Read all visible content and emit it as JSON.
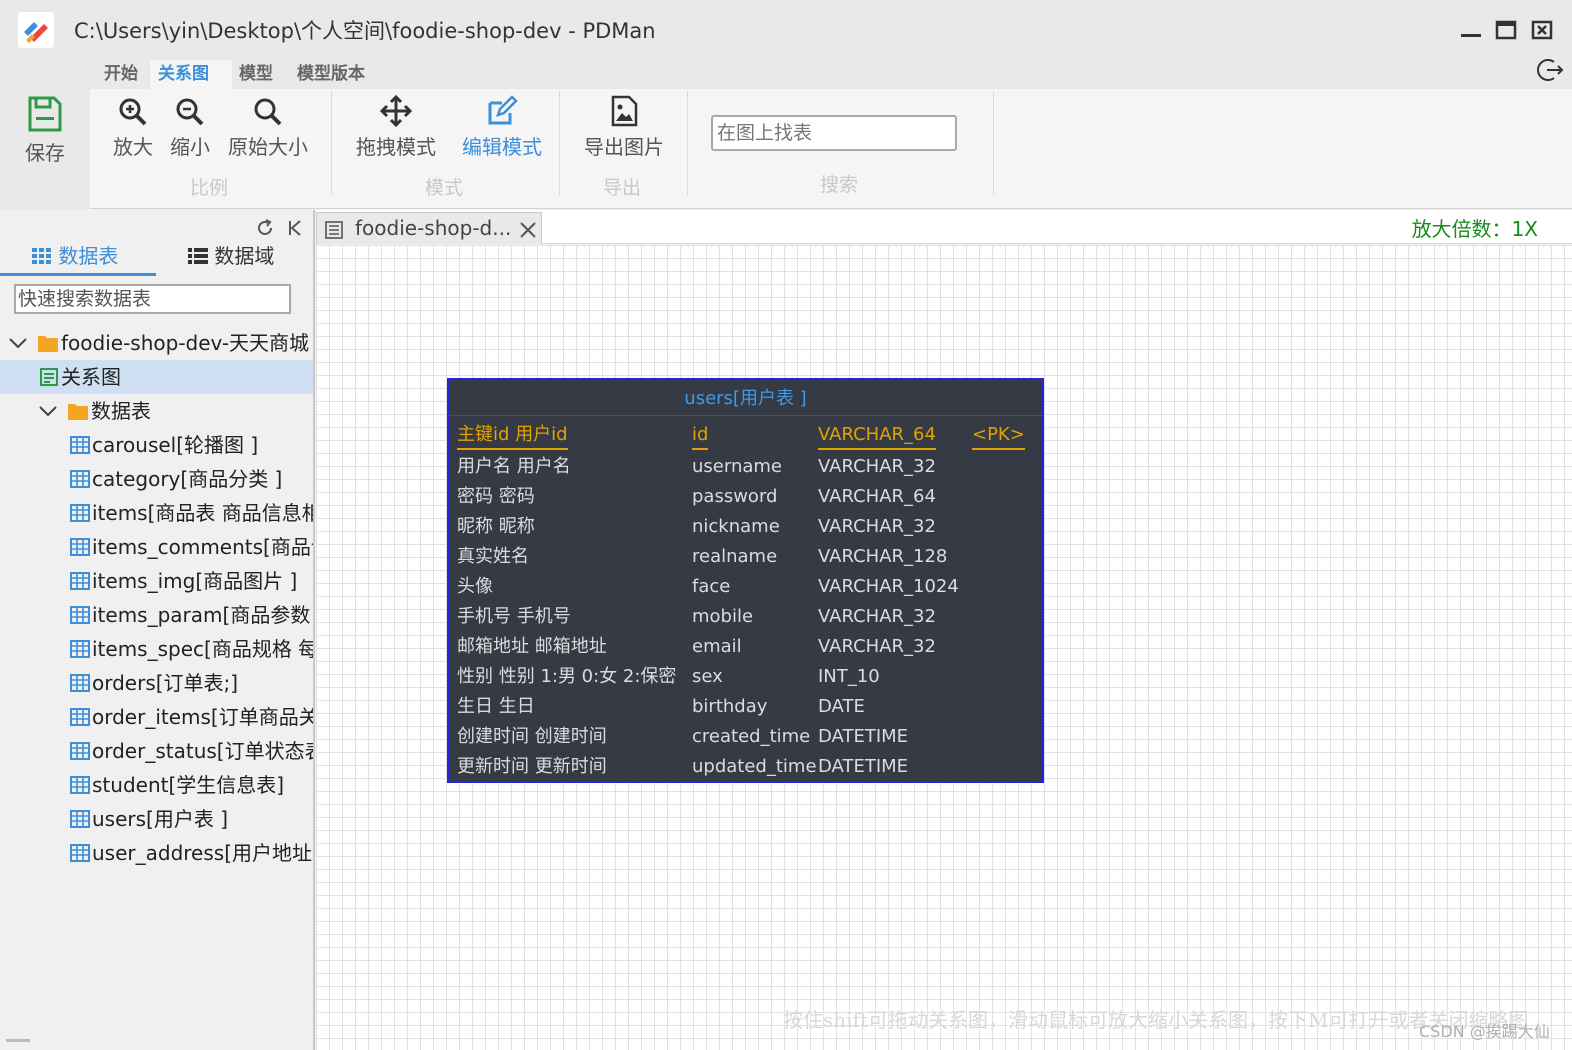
{
  "window": {
    "title": "C:\\Users\\yin\\Desktop\\个人空间\\foodie-shop-dev - PDMan",
    "app_icon": "pdman-logo-icon",
    "controls": [
      "minimize-icon",
      "maximize-icon",
      "close-icon"
    ]
  },
  "menu": {
    "tabs": [
      {
        "label": "开始",
        "active": false
      },
      {
        "label": "关系图",
        "active": true
      },
      {
        "label": "模型",
        "active": false
      },
      {
        "label": "模型版本",
        "active": false
      }
    ],
    "logout_icon": "logout-icon"
  },
  "ribbon": {
    "save": {
      "label": "保存",
      "icon": "save-icon"
    },
    "scale_group": {
      "label": "比例",
      "zoom_in": {
        "label": "放大",
        "icon": "zoom-in-icon"
      },
      "zoom_out": {
        "label": "缩小",
        "icon": "zoom-out-icon"
      },
      "original": {
        "label": "原始大小",
        "icon": "search-icon"
      }
    },
    "mode_group": {
      "label": "模式",
      "drag": {
        "label": "拖拽模式",
        "icon": "move-icon"
      },
      "edit": {
        "label": "编辑模式",
        "icon": "edit-icon",
        "active": true
      }
    },
    "export_group": {
      "label": "导出",
      "export_image": {
        "label": "导出图片",
        "icon": "image-file-icon"
      }
    },
    "search_group": {
      "label": "搜索",
      "placeholder": "在图上找表"
    },
    "accent_color": "#3d8fd8"
  },
  "sidebar": {
    "tabs": [
      {
        "label": "数据表",
        "active": true,
        "icon": "grid-icon"
      },
      {
        "label": "数据域",
        "active": false,
        "icon": "list-icon"
      }
    ],
    "tools": [
      "refresh-icon",
      "collapse-icon"
    ],
    "search_placeholder": "快速搜索数据表",
    "tree": {
      "project": "foodie-shop-dev-天天商城",
      "diagram": "关系图",
      "folder": "数据表",
      "tables": [
        "carousel[轮播图 ]",
        "category[商品分类 ]",
        "items[商品表 商品信息相",
        "items_comments[商品评",
        "items_img[商品图片 ]",
        "items_param[商品参数 ]",
        "items_spec[商品规格 每一",
        "orders[订单表;]",
        "order_items[订单商品关",
        "order_status[订单状态表",
        "student[学生信息表]",
        "users[用户表 ]",
        "user_address[用户地址表"
      ]
    }
  },
  "doc_tab": {
    "label": "foodie-shop-d...",
    "icon": "document-icon",
    "close_icon": "close-icon"
  },
  "zoom_text": "放大倍数：1X",
  "zoom_color": "#1a8a1a",
  "entity": {
    "title": "users[用户表 ]",
    "fields": [
      {
        "comment": "主键id 用户id",
        "name": "id",
        "type": "VARCHAR_64",
        "key": "<PK>"
      },
      {
        "comment": "用户名 用户名",
        "name": "username",
        "type": "VARCHAR_32",
        "key": ""
      },
      {
        "comment": "密码 密码",
        "name": "password",
        "type": "VARCHAR_64",
        "key": ""
      },
      {
        "comment": "昵称 昵称",
        "name": "nickname",
        "type": "VARCHAR_32",
        "key": ""
      },
      {
        "comment": "真实姓名",
        "name": "realname",
        "type": "VARCHAR_128",
        "key": ""
      },
      {
        "comment": "头像",
        "name": "face",
        "type": "VARCHAR_1024",
        "key": ""
      },
      {
        "comment": "手机号 手机号",
        "name": "mobile",
        "type": "VARCHAR_32",
        "key": ""
      },
      {
        "comment": "邮箱地址 邮箱地址",
        "name": "email",
        "type": "VARCHAR_32",
        "key": ""
      },
      {
        "comment": "性别 性别 1:男  0:女  2:保密",
        "name": "sex",
        "type": "INT_10",
        "key": ""
      },
      {
        "comment": "生日 生日",
        "name": "birthday",
        "type": "DATE",
        "key": ""
      },
      {
        "comment": "创建时间 创建时间",
        "name": "created_time",
        "type": "DATETIME",
        "key": ""
      },
      {
        "comment": "更新时间 更新时间",
        "name": "updated_time",
        "type": "DATETIME",
        "key": ""
      }
    ],
    "colors": {
      "background": "#353a45",
      "border": "#2323e0",
      "title": "#3d9ae8",
      "pk": "#e0a300"
    }
  },
  "hint": "按住shift可拖动关系图，滑动鼠标可放大缩小关系图，按下M可打开或者关闭缩略图",
  "watermark": "CSDN @挨踢大仙"
}
